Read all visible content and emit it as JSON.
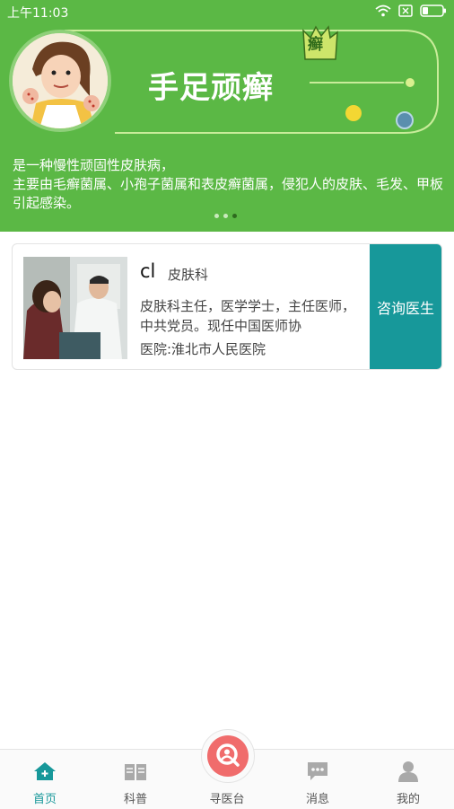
{
  "status_bar": {
    "time": "上午11:03"
  },
  "banner": {
    "title": "手足顽癣",
    "seal_text": "癣",
    "description": "是一种慢性顽固性皮肤病，\n主要由毛癣菌属、小孢子菌属和表皮癣菌属，侵犯人的皮肤、毛发、甲板引起感染。",
    "carousel": {
      "count": 3,
      "active_index": 2
    }
  },
  "doctor_card": {
    "name": "cl",
    "department": "皮肤科",
    "intro": "皮肤科主任，医学学士，主任医师，中共党员。现任中国医师协",
    "hospital": "医院:淮北市人民医院",
    "consult_label": "咨询医生"
  },
  "tabbar": {
    "items": [
      {
        "label": "首页",
        "icon": "home-icon",
        "active": true
      },
      {
        "label": "科普",
        "icon": "book-icon",
        "active": false
      },
      {
        "label": "寻医台",
        "icon": "search-doctor-icon",
        "active": false
      },
      {
        "label": "消息",
        "icon": "message-icon",
        "active": false
      },
      {
        "label": "我的",
        "icon": "profile-icon",
        "active": false
      }
    ]
  },
  "colors": {
    "banner_green": "#5bb845",
    "accent_teal": "#17989a",
    "center_red": "#f06c6c"
  }
}
